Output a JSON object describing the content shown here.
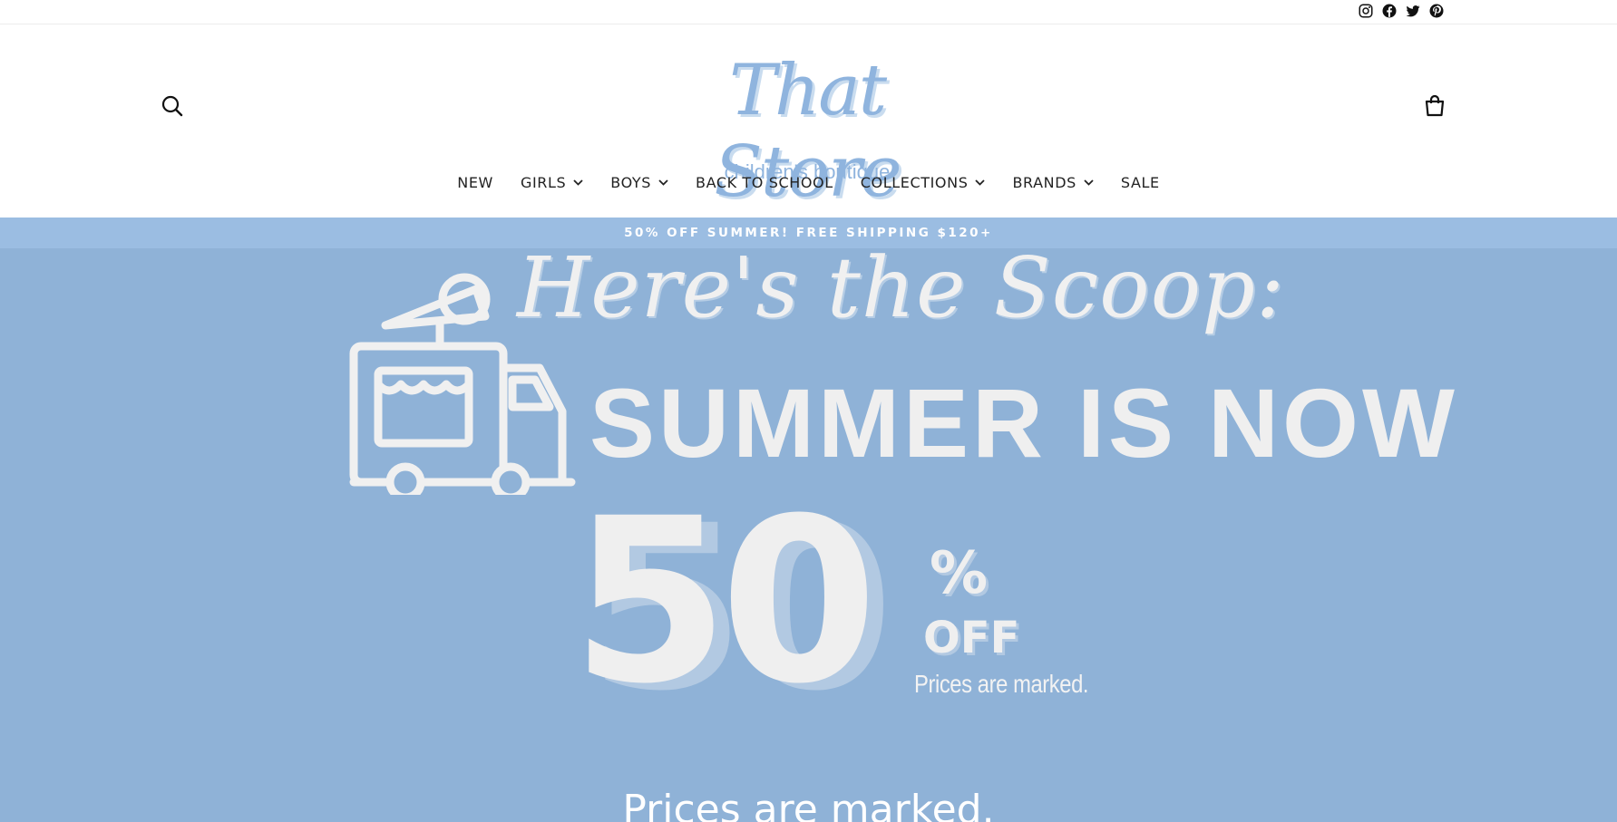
{
  "social": {
    "icons": [
      "instagram-icon",
      "facebook-icon",
      "twitter-icon",
      "pinterest-icon"
    ]
  },
  "header": {
    "logo_script": "That Store",
    "logo_sub": "children's boutique",
    "search_icon": "search-icon",
    "cart_icon": "cart-icon"
  },
  "nav": {
    "items": [
      {
        "label": "NEW",
        "dropdown": false
      },
      {
        "label": "GIRLS",
        "dropdown": true
      },
      {
        "label": "BOYS",
        "dropdown": true
      },
      {
        "label": "BACK TO SCHOOL",
        "dropdown": false
      },
      {
        "label": "COLLECTIONS",
        "dropdown": true
      },
      {
        "label": "BRANDS",
        "dropdown": true
      },
      {
        "label": "SALE",
        "dropdown": false
      }
    ]
  },
  "announcement": {
    "text": "50% OFF SUMMER! FREE SHIPPING $120+"
  },
  "hero": {
    "script_heading": "Here's the Scoop:",
    "heading": "SUMMER IS NOW",
    "big_number": "50",
    "percent": "%",
    "off": "OFF",
    "small_note": "Prices are marked.",
    "caption": "Prices are marked."
  },
  "colors": {
    "brand_blue": "#8fb4de",
    "announce_bg": "#9bbde2",
    "hero_bg": "#8fb2d7"
  }
}
